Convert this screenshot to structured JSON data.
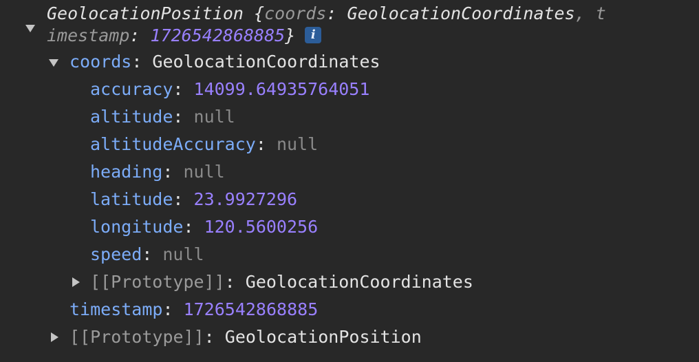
{
  "object": {
    "class_name": "GeolocationPosition",
    "summary_open": "{",
    "summary_coords_key": "coords",
    "summary_coords_val": "GeolocationCoordinates",
    "summary_sep": ", t",
    "summary_line2_key": "imestamp",
    "summary_timestamp": "1726542868885",
    "summary_close": "}",
    "info_icon": "i"
  },
  "coords": {
    "key": "coords",
    "type": "GeolocationCoordinates",
    "properties": [
      {
        "key": "accuracy",
        "value": "14099.64935764051",
        "kind": "number"
      },
      {
        "key": "altitude",
        "value": "null",
        "kind": "null"
      },
      {
        "key": "altitudeAccuracy",
        "value": "null",
        "kind": "null"
      },
      {
        "key": "heading",
        "value": "null",
        "kind": "null"
      },
      {
        "key": "latitude",
        "value": "23.9927296",
        "kind": "number"
      },
      {
        "key": "longitude",
        "value": "120.5600256",
        "kind": "number"
      },
      {
        "key": "speed",
        "value": "null",
        "kind": "null"
      }
    ],
    "prototype_key": "[[Prototype]]",
    "prototype_val": "GeolocationCoordinates"
  },
  "timestamp": {
    "key": "timestamp",
    "value": "1726542868885"
  },
  "prototype": {
    "key": "[[Prototype]]",
    "value": "GeolocationPosition"
  },
  "colors": {
    "background": "#282828",
    "key": "#7cacf8",
    "number": "#9980ff",
    "null": "#8a8a8a",
    "text": "#e3e3e3"
  }
}
